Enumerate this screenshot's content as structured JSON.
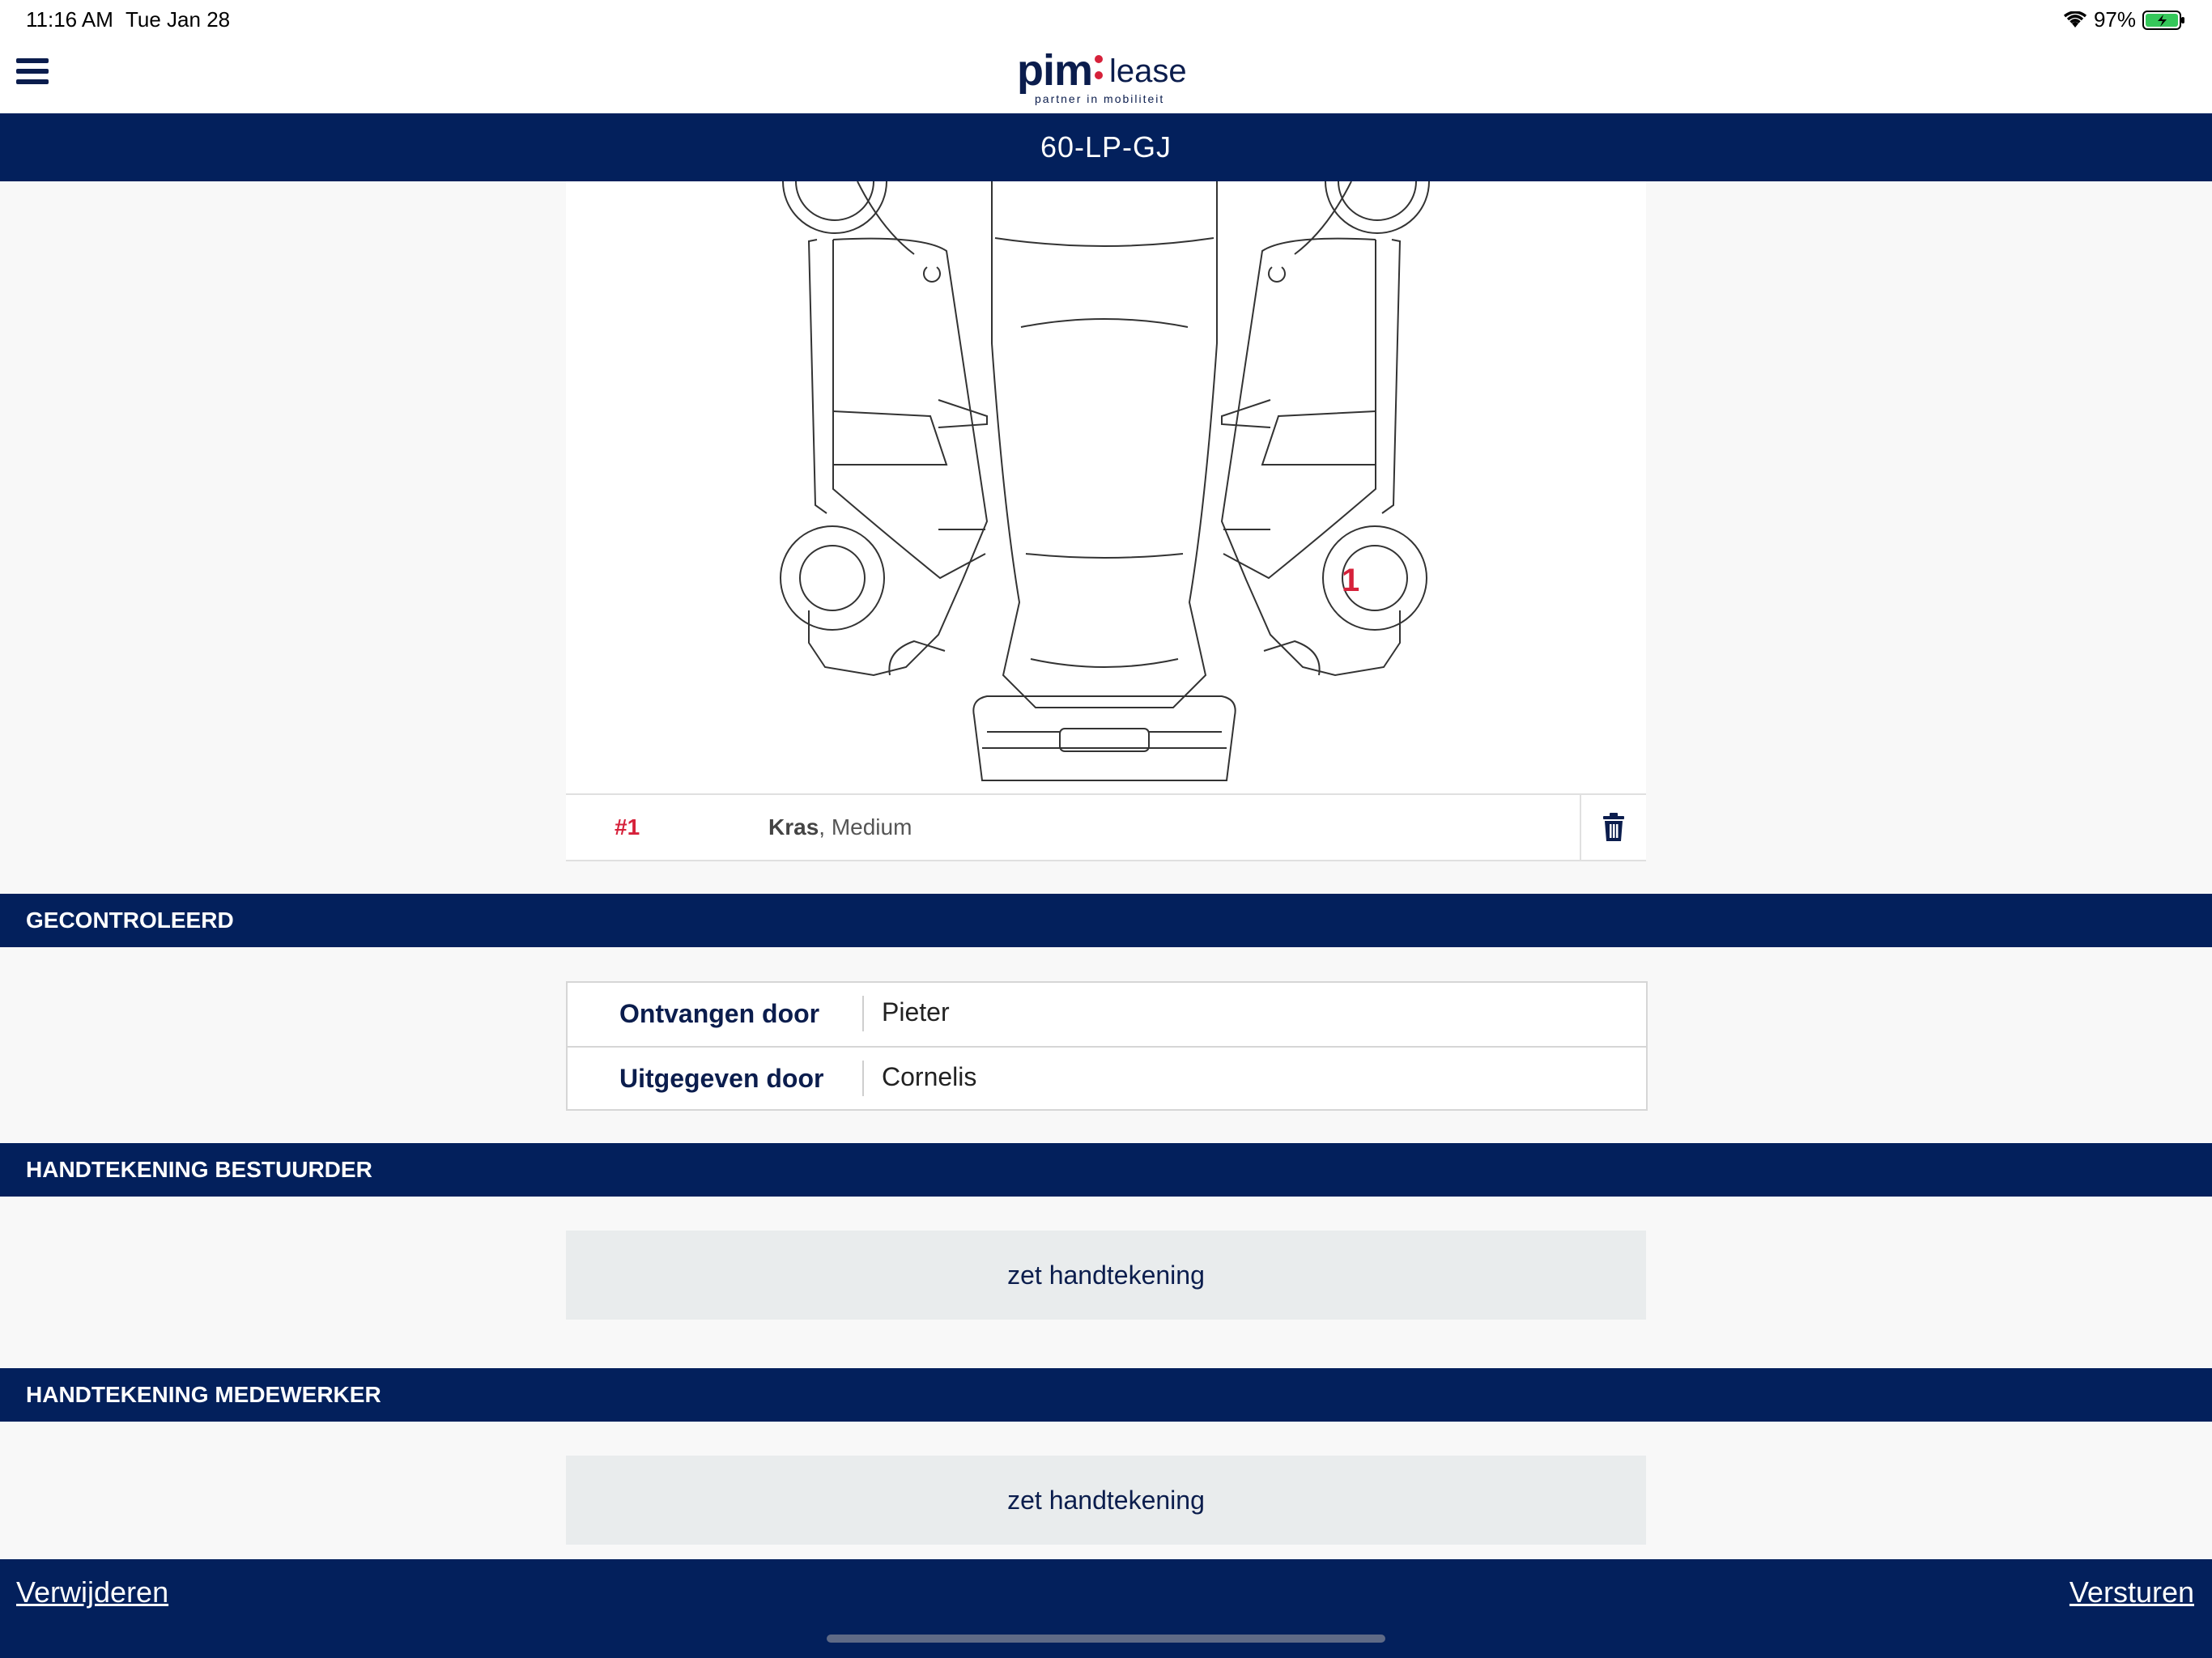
{
  "status_bar": {
    "time": "11:16 AM",
    "date": "Tue Jan 28",
    "battery": "97%"
  },
  "header": {
    "logo_brand": "pim",
    "logo_product": "lease",
    "logo_tagline": "partner in mobiliteit"
  },
  "vehicle": {
    "plate": "60-LP-GJ",
    "marker_label": "1"
  },
  "damages": [
    {
      "number": "#1",
      "type": "Kras",
      "severity": ", Medium"
    }
  ],
  "sections": {
    "checked": "GECONTROLEERD",
    "driver_signature": "HANDTEKENING BESTUURDER",
    "employee_signature": "HANDTEKENING MEDEWERKER"
  },
  "info": {
    "received_label": "Ontvangen door",
    "received_value": "Pieter",
    "issued_label": "Uitgegeven door",
    "issued_value": "Cornelis"
  },
  "signature_button": "zet handtekening",
  "footer": {
    "delete_label": "Verwijderen",
    "send_label": "Versturen"
  },
  "colors": {
    "navy": "#03205c",
    "accent_red": "#d6213a",
    "button_grey": "#e9eced"
  }
}
